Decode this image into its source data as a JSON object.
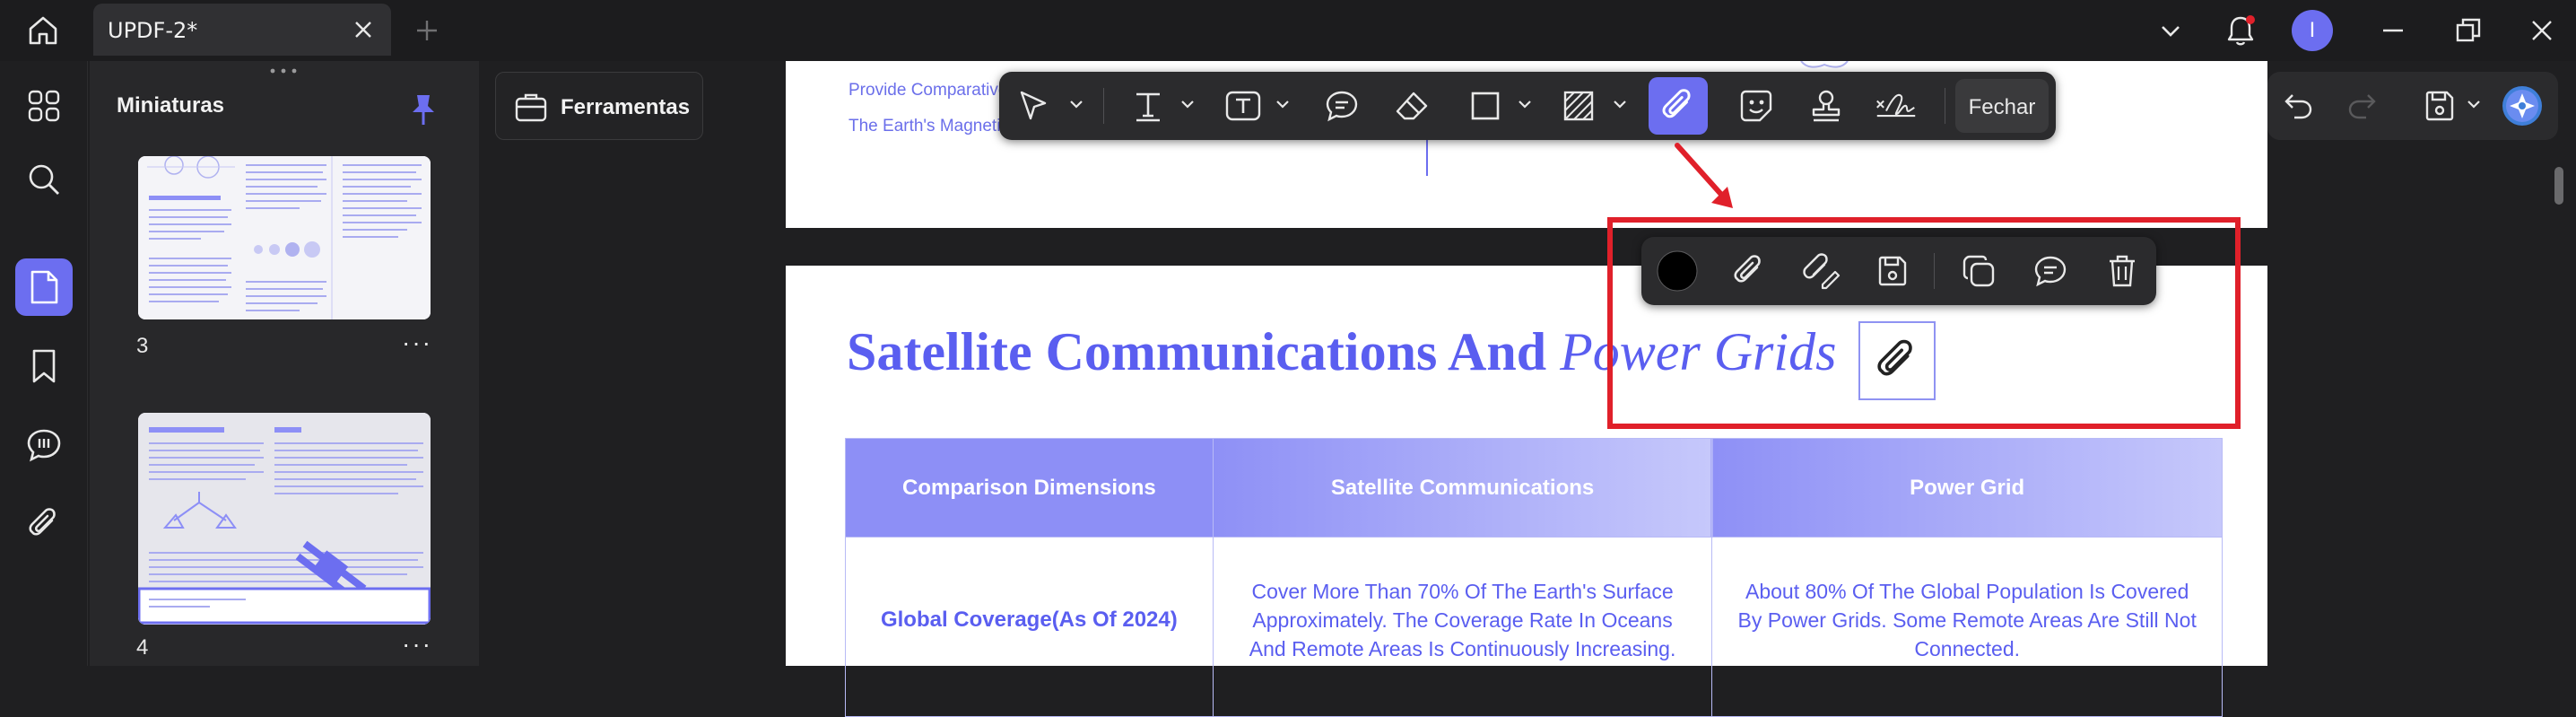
{
  "titlebar": {
    "tab_title": "UPDF-2*",
    "avatar_letter": "I",
    "avatar_color": "#6c6ef0"
  },
  "rail": {
    "items": [
      "thumbnails-grid-icon",
      "search-icon",
      "pages-icon",
      "bookmark-icon",
      "comment-icon",
      "attachment-icon"
    ],
    "active": "pages-icon"
  },
  "thumbnails": {
    "title": "Miniaturas",
    "pages": [
      {
        "number": "3",
        "more": "···"
      },
      {
        "number": "4",
        "more": "···"
      }
    ]
  },
  "tools": {
    "label": "Ferramentas"
  },
  "annotation_toolbar": {
    "tools": [
      "select-icon",
      "text-icon",
      "textbox-icon",
      "comment-icon",
      "eraser-icon",
      "rectangle-icon",
      "hatch-icon",
      "attachment-icon",
      "sticker-icon",
      "stamp-icon",
      "signature-icon"
    ],
    "active": "attachment-icon",
    "close_label": "Fechar"
  },
  "attachment_popup": {
    "color": "#000000",
    "tools": [
      "color-swatch",
      "attachment-icon",
      "replace-attachment-icon",
      "save-icon",
      "copy-icon",
      "comment-icon",
      "delete-icon"
    ]
  },
  "document": {
    "page1_lines": [
      "Provide Comparative",
      "The Earth's Magneti"
    ],
    "heading_main": "Satellite Communications And ",
    "heading_italic": "Power Grids",
    "table": {
      "headers": [
        "Comparison Dimensions",
        "Satellite Communications",
        "Power Grid"
      ],
      "rows": [
        {
          "c1": "Global Coverage(As Of 2024)",
          "c2": "Cover More Than 70% Of The Earth's Surface Approximately. The Coverage Rate In Oceans And Remote Areas Is Continuously Increasing.",
          "c3": "About 80% Of The Global Population Is Covered By Power Grids. Some Remote Areas Are Still Not Connected."
        }
      ]
    }
  },
  "accent_color": "#6c6ef0",
  "highlight_color": "#e0202a"
}
